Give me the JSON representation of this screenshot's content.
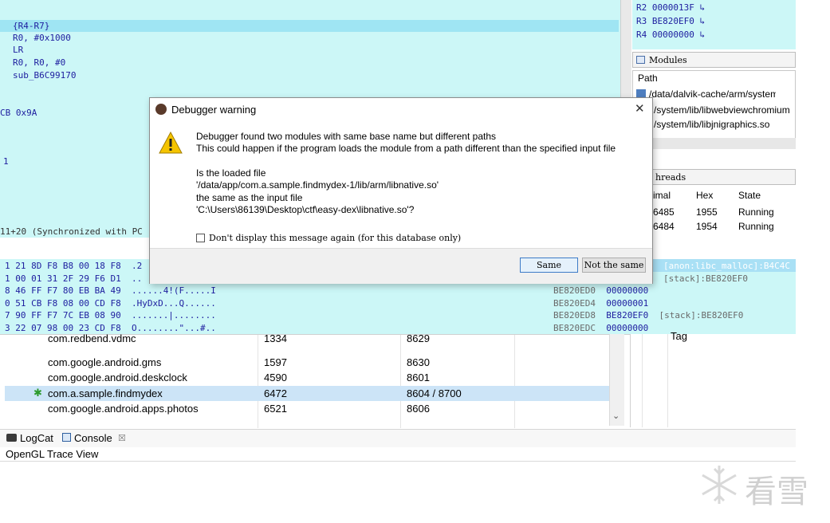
{
  "disassembly": {
    "lines": [
      "{R4-R7}",
      "R0, #0x1000",
      "LR",
      "R0, R0, #0",
      "sub_B6C99170"
    ],
    "fragment_cb": "CB 0x9A",
    "fragment_1": "1",
    "sync_status": "11+20 (Synchronized with PC"
  },
  "registers": [
    {
      "name": "R2",
      "value": "0000013F"
    },
    {
      "name": "R3",
      "value": "BE820EF0"
    },
    {
      "name": "R4",
      "value": "00000000"
    }
  ],
  "modules": {
    "title": "Modules",
    "header": "Path",
    "rows": [
      "/data/dalvik-cache/arm/system@",
      "/system/lib/libwebviewchromium",
      "/system/lib/libjnigraphics.so"
    ]
  },
  "threads": {
    "title": "hreads",
    "columns": [
      "imal",
      "Hex",
      "State"
    ],
    "rows": [
      {
        "dec": "6485",
        "hex": "1955",
        "state": "Running"
      },
      {
        "dec": "6484",
        "hex": "1954",
        "state": "Running"
      }
    ]
  },
  "hex_dump": [
    {
      "bytes": "1 21 8D F8 B8 00 18 F8",
      "ascii": ".2"
    },
    {
      "bytes": "1 00 01 31 2F 29 F6 D1",
      "ascii": ".."
    },
    {
      "bytes": "8 46 FF F7 80 EB BA 49",
      "ascii": "......4!(F.....I"
    },
    {
      "bytes": "0 51 CB F8 08 00 CD F8",
      "ascii": ".HyDxD...Q......"
    },
    {
      "bytes": "7 90 FF F7 7C EB 08 90",
      "ascii": ".......|........"
    },
    {
      "bytes": "3 22 07 98 00 23 CD F8",
      "ascii": "O........\"...#.."
    }
  ],
  "stack": [
    {
      "addr": "",
      "value": "",
      "note": "[anon:libc_malloc]:B4C4C"
    },
    {
      "addr": "",
      "value": "",
      "note": "[stack]:BE820EF0"
    },
    {
      "addr": "BE820ED0",
      "value": "00000000",
      "note": ""
    },
    {
      "addr": "BE820ED4",
      "value": "00000001",
      "note": ""
    },
    {
      "addr": "BE820ED8",
      "value": "BE820EF0",
      "note": "[stack]:BE820EF0"
    },
    {
      "addr": "BE820EDC",
      "value": "00000000",
      "note": ""
    }
  ],
  "processes": [
    {
      "name": "com.redbend.vdmc",
      "pid": "1334",
      "port": "8629",
      "selected": false
    },
    {
      "name": "com.google.android.gms",
      "pid": "1597",
      "port": "8630",
      "selected": false
    },
    {
      "name": "com.google.android.deskclock",
      "pid": "4590",
      "port": "8601",
      "selected": false
    },
    {
      "name": "com.a.sample.findmydex",
      "pid": "6472",
      "port": "8604 / 8700",
      "selected": true
    },
    {
      "name": "com.google.android.apps.photos",
      "pid": "6521",
      "port": "8606",
      "selected": false
    }
  ],
  "process_right_fragment": "Tag",
  "bottom_tabs": {
    "logcat": "LogCat",
    "console": "Console",
    "close_glyph": "☒"
  },
  "opengl_trace": "OpenGL Trace View",
  "dialog": {
    "title": "Debugger warning",
    "close_glyph": "✕",
    "message_line1": "Debugger found two modules with same base name but different paths",
    "message_line2": "This could happen if the program loads the module from a path different than the specified input file",
    "is_loaded": "Is the loaded file",
    "loaded_path": "'/data/app/com.a.sample.findmydex-1/lib/arm/libnative.so'",
    "same_as": "the same as the input file",
    "input_path": "'C:\\Users\\86139\\Desktop\\ctf\\easy-dex\\libnative.so'?",
    "checkbox_label": "Don't display this message again (for this database only)",
    "same_button": "Same",
    "not_same_button": "Not the same"
  },
  "watermark": "看雪",
  "colors": {
    "ida_bg": "#ccf7f7",
    "ida_text": "#1d1d9f",
    "highlight": "#9fe5f3",
    "selection": "#cce4f7"
  }
}
